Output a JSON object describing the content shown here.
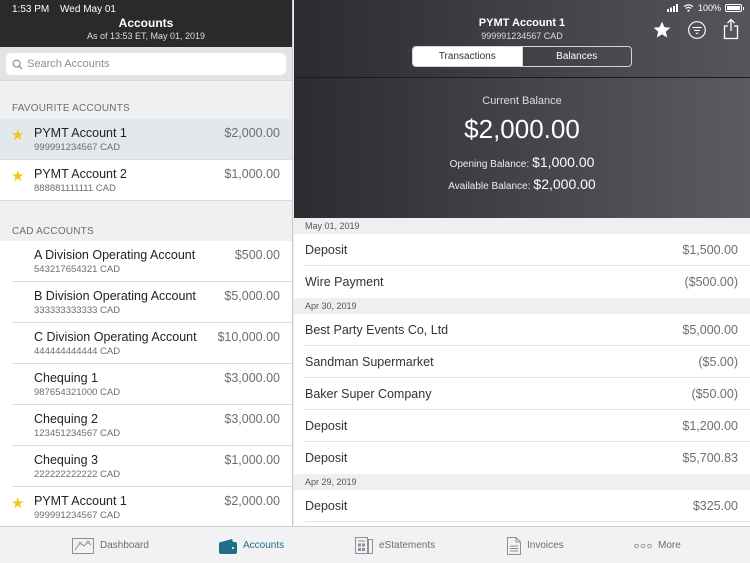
{
  "status_bar": {
    "time": "1:53 PM",
    "date": "Wed May 01",
    "battery": "100%"
  },
  "left": {
    "title": "Accounts",
    "subtitle": "As of 13:53 ET, May 01, 2019",
    "search_placeholder": "Search Accounts",
    "favourites_label": "FAVOURITE ACCOUNTS",
    "favourites": [
      {
        "name": "PYMT Account 1",
        "number": "999991234567 CAD",
        "amount": "$2,000.00",
        "starred": true,
        "selected": true
      },
      {
        "name": "PYMT Account 2",
        "number": "888881111111 CAD",
        "amount": "$1,000.00",
        "starred": true,
        "selected": false
      }
    ],
    "cad_label": "CAD ACCOUNTS",
    "cad_accounts": [
      {
        "name": "A Division Operating Account",
        "number": "543217654321 CAD",
        "amount": "$500.00",
        "starred": false
      },
      {
        "name": "B Division Operating Account",
        "number": "333333333333 CAD",
        "amount": "$5,000.00",
        "starred": false
      },
      {
        "name": "C Division Operating Account",
        "number": "444444444444 CAD",
        "amount": "$10,000.00",
        "starred": false
      },
      {
        "name": "Chequing 1",
        "number": "987654321000 CAD",
        "amount": "$3,000.00",
        "starred": false
      },
      {
        "name": "Chequing 2",
        "number": "123451234567 CAD",
        "amount": "$3,000.00",
        "starred": false
      },
      {
        "name": "Chequing 3",
        "number": "222222222222 CAD",
        "amount": "$1,000.00",
        "starred": false
      },
      {
        "name": "PYMT Account 1",
        "number": "999991234567 CAD",
        "amount": "$2,000.00",
        "starred": true
      }
    ]
  },
  "right": {
    "account_name": "PYMT Account 1",
    "account_number": "999991234567 CAD",
    "tabs": [
      {
        "label": "Transactions",
        "active": true
      },
      {
        "label": "Balances",
        "active": false
      }
    ],
    "icons": [
      "star-icon",
      "filter-icon",
      "share-icon"
    ],
    "current_balance_label": "Current Balance",
    "current_balance": "$2,000.00",
    "opening_balance_label": "Opening Balance:",
    "opening_balance": "$1,000.00",
    "available_balance_label": "Available Balance:",
    "available_balance": "$2,000.00",
    "groups": [
      {
        "date": "May 01, 2019",
        "transactions": [
          {
            "description": "Deposit",
            "amount": "$1,500.00"
          },
          {
            "description": "Wire Payment",
            "amount": "($500.00)"
          }
        ]
      },
      {
        "date": "Apr 30, 2019",
        "transactions": [
          {
            "description": "Best Party Events Co, Ltd",
            "amount": "$5,000.00"
          },
          {
            "description": "Sandman Supermarket",
            "amount": "($5.00)"
          },
          {
            "description": "Baker Super Company",
            "amount": "($50.00)"
          },
          {
            "description": "Deposit",
            "amount": "$1,200.00"
          },
          {
            "description": "Deposit",
            "amount": "$5,700.83"
          }
        ]
      },
      {
        "date": "Apr 29, 2019",
        "transactions": [
          {
            "description": "Deposit",
            "amount": "$325.00"
          }
        ]
      }
    ]
  },
  "tabbar": {
    "items": [
      {
        "label": "Dashboard",
        "icon": "dashboard-icon",
        "active": false
      },
      {
        "label": "Accounts",
        "icon": "wallet-icon",
        "active": true
      },
      {
        "label": "eStatements",
        "icon": "estatements-icon",
        "active": false
      },
      {
        "label": "Invoices",
        "icon": "invoice-icon",
        "active": false
      },
      {
        "label": "More",
        "icon": "more-icon",
        "active": false
      }
    ]
  },
  "colors": {
    "accent": "#1f6d8a",
    "star": "#f5c518",
    "header_dark": "#2a2a2d",
    "selected_row": "#e2e8ec"
  }
}
